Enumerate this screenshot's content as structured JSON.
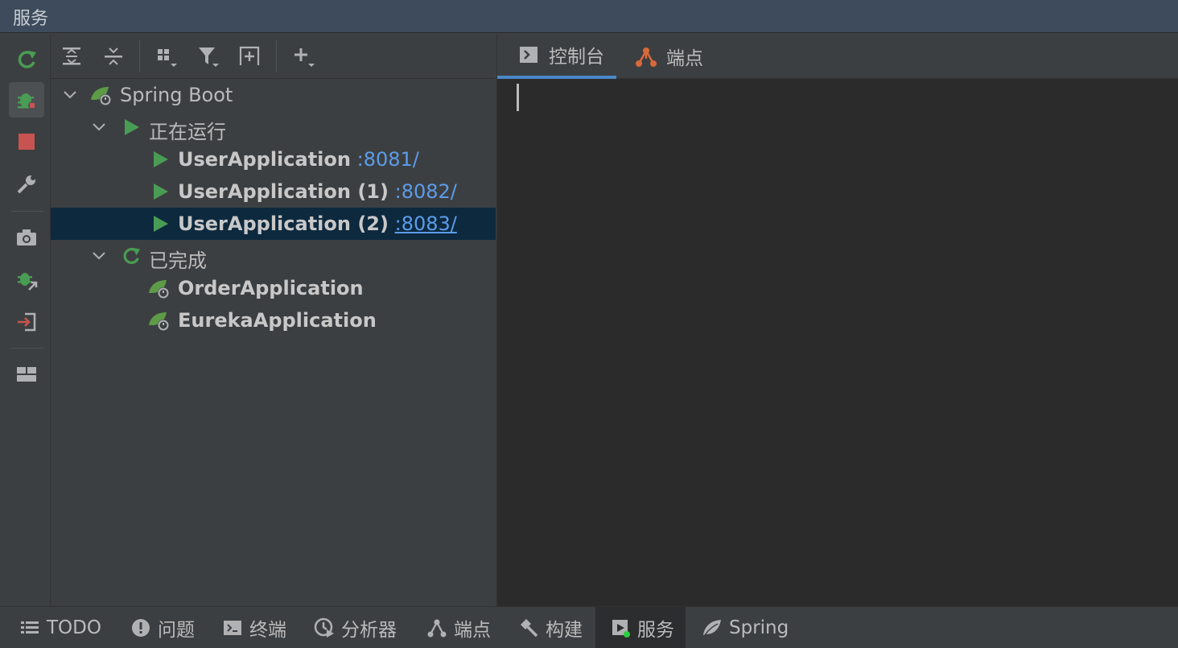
{
  "window": {
    "title": "服务"
  },
  "left_toolbar": {
    "icons": [
      "rerun-icon",
      "debug-icon",
      "stop-icon",
      "wrench-icon",
      "camera-icon",
      "attach-debugger-icon",
      "exit-icon",
      "layout-icon"
    ]
  },
  "tree_toolbar": {
    "icons": [
      "expand-all-icon",
      "collapse-all-icon",
      "group-by-icon",
      "filter-icon",
      "new-pane-icon",
      "add-icon"
    ]
  },
  "tree": {
    "root": {
      "label": "Spring Boot"
    },
    "running_group": {
      "label": "正在运行"
    },
    "running": [
      {
        "name": "UserApplication",
        "port": ":8081/"
      },
      {
        "name": "UserApplication (1)",
        "port": ":8082/"
      },
      {
        "name": "UserApplication (2)",
        "port": ":8083/"
      }
    ],
    "finished_group": {
      "label": "已完成"
    },
    "finished": [
      {
        "name": "OrderApplication"
      },
      {
        "name": "EurekaApplication"
      }
    ]
  },
  "console": {
    "tabs": [
      {
        "label": "控制台",
        "icon": "console-icon"
      },
      {
        "label": "端点",
        "icon": "endpoints-icon"
      }
    ]
  },
  "bottom_bar": {
    "tabs": [
      {
        "label": "TODO",
        "icon": "list-icon"
      },
      {
        "label": "问题",
        "icon": "problems-icon"
      },
      {
        "label": "终端",
        "icon": "terminal-icon"
      },
      {
        "label": "分析器",
        "icon": "profiler-icon"
      },
      {
        "label": "端点",
        "icon": "endpoints-icon"
      },
      {
        "label": "构建",
        "icon": "hammer-icon"
      },
      {
        "label": "服务",
        "icon": "services-icon"
      },
      {
        "label": "Spring",
        "icon": "spring-leaf-icon"
      }
    ]
  },
  "colors": {
    "accent": "#4a88c7",
    "run_green": "#499c54",
    "link_blue": "#5c9ceb",
    "stop_red": "#c75450",
    "selection": "#0d293e"
  }
}
